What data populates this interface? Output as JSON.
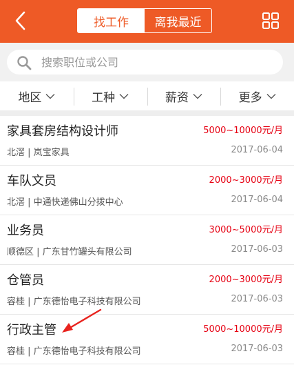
{
  "header": {
    "tabs": [
      {
        "label": "找工作",
        "active": true
      },
      {
        "label": "离我最近",
        "active": false
      }
    ],
    "accent_color": "#ee5a26"
  },
  "search": {
    "placeholder": "搜索职位或公司"
  },
  "filters": [
    {
      "label": "地区"
    },
    {
      "label": "工种"
    },
    {
      "label": "薪资"
    },
    {
      "label": "更多"
    }
  ],
  "jobs": [
    {
      "title": "家具套房结构设计师",
      "salary": "5000~10000元/月",
      "company": "北滘 | 岚宝家具",
      "date": "2017-06-04"
    },
    {
      "title": "车队文员",
      "salary": "2000~3000元/月",
      "company": "北滘 | 中通快递佛山分拨中心",
      "date": "2017-06-04"
    },
    {
      "title": "业务员",
      "salary": "3000~5000元/月",
      "company": "顺德区 | 广东甘竹罐头有限公司",
      "date": "2017-06-03"
    },
    {
      "title": "仓管员",
      "salary": "2000~3000元/月",
      "company": "容桂 | 广东德怡电子科技有限公司",
      "date": "2017-06-03"
    },
    {
      "title": "行政主管",
      "salary": "5000~10000元/月",
      "company": "容桂 | 广东德怡电子科技有限公司",
      "date": "2017-06-03"
    }
  ],
  "colors": {
    "salary": "#e60012",
    "annotation_arrow": "#e8231e"
  }
}
